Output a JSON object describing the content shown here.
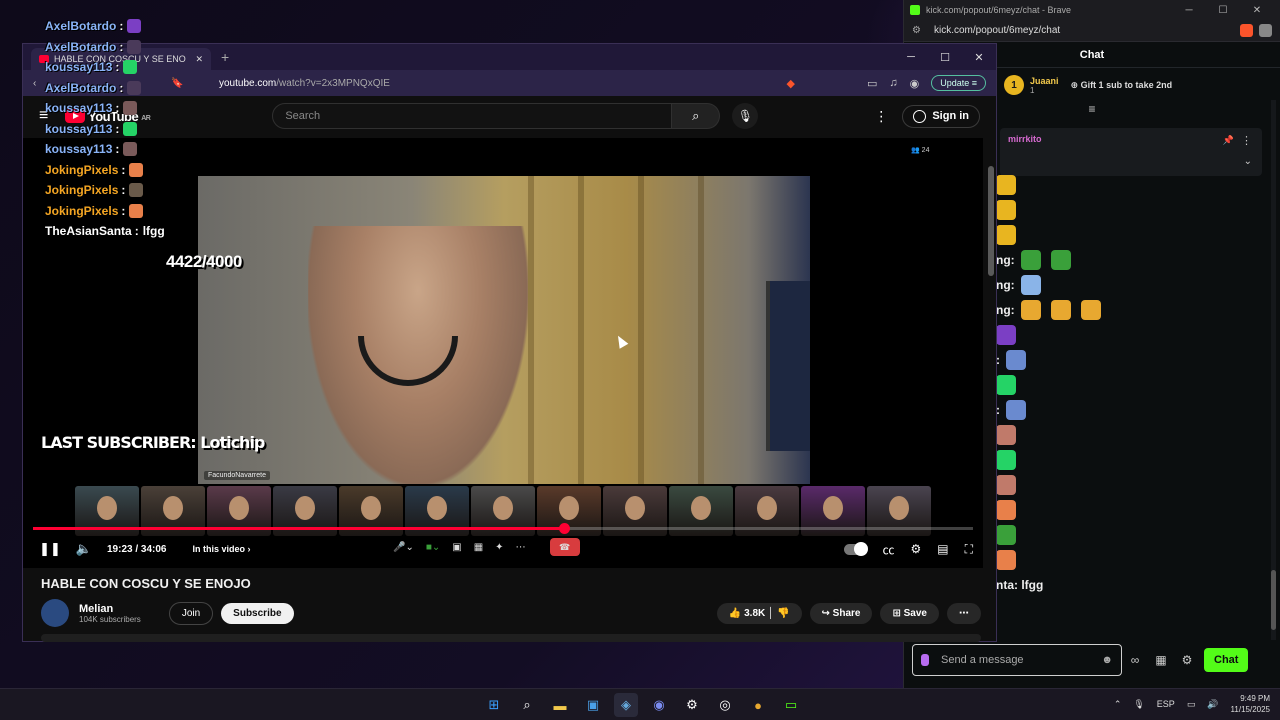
{
  "overlay": {
    "chat": [
      {
        "user": "AxelBotardo",
        "text": "",
        "color": "#8ab4f8",
        "emote": "#7b3fc4"
      },
      {
        "user": "AxelBotardo",
        "text": "",
        "color": "#8ab4f8",
        "emote": "#4a3a5a"
      },
      {
        "user": "koussay113",
        "text": "",
        "color": "#8ab4f8",
        "emote": "#25d366"
      },
      {
        "user": "AxelBotardo",
        "text": "",
        "color": "#8ab4f8",
        "emote": "#4a3a5a"
      },
      {
        "user": "koussay113",
        "text": "",
        "color": "#8ab4f8",
        "emote": "#7a5a5a"
      },
      {
        "user": "koussay113",
        "text": "",
        "color": "#8ab4f8",
        "emote": "#25d366"
      },
      {
        "user": "koussay113",
        "text": "",
        "color": "#8ab4f8",
        "emote": "#7a5a5a"
      },
      {
        "user": "JokingPixels",
        "text": "",
        "color": "#f5a623",
        "emote": "#e8804a"
      },
      {
        "user": "JokingPixels",
        "text": "",
        "color": "#f5a623",
        "emote": "#6a5a4a"
      },
      {
        "user": "JokingPixels",
        "text": "",
        "color": "#f5a623",
        "emote": "#e8804a"
      },
      {
        "user": "TheAsianSanta",
        "text": "lfgg",
        "color": "#ffffff",
        "emote": ""
      }
    ],
    "sub_goal": "4422/4000",
    "last_subscriber": "LAST SUBSCRIBER: Lotichip"
  },
  "kick": {
    "window_title": "kick.com/popout/6meyz/chat - Brave",
    "url": "kick.com/popout/6meyz/chat",
    "chat_header": "Chat",
    "gifter": {
      "rank": "1",
      "name": "Juaani",
      "count": "1",
      "cta": "Gift 1 sub to take 2nd"
    },
    "pinned_user": "mirrkito",
    "messages": [
      {
        "prefix": "",
        "emotes": [
          "#e8b520"
        ]
      },
      {
        "prefix": "",
        "emotes": [
          "#e8b520"
        ]
      },
      {
        "prefix": "",
        "emotes": [
          "#e8b520"
        ]
      },
      {
        "prefix": "ng:",
        "emotes": [
          "#3aa03a",
          "#3aa03a"
        ]
      },
      {
        "prefix": "ng:",
        "emotes": [
          "#8ab4e8"
        ]
      },
      {
        "prefix": "ng:",
        "emotes": [
          "#e8a830",
          "#e8a830",
          "#e8a830"
        ]
      },
      {
        "prefix": "",
        "emotes": [
          "#7b3fc4"
        ]
      },
      {
        "prefix": ":",
        "emotes": [
          "#6a8acf"
        ]
      },
      {
        "prefix": "",
        "emotes": [
          "#25d366"
        ]
      },
      {
        "prefix": ":",
        "emotes": [
          "#6a8acf"
        ]
      },
      {
        "prefix": "",
        "emotes": [
          "#c07a6a"
        ]
      },
      {
        "prefix": "",
        "emotes": [
          "#25d366"
        ]
      },
      {
        "prefix": "",
        "emotes": [
          "#c07a6a"
        ]
      },
      {
        "prefix": "",
        "emotes": [
          "#e8804a"
        ]
      },
      {
        "prefix": "",
        "emotes": [
          "#3aa03a"
        ]
      },
      {
        "prefix": "",
        "emotes": [
          "#e8804a"
        ]
      },
      {
        "prefix": "nta: lfgg",
        "emotes": []
      }
    ],
    "input_placeholder": "Send a message",
    "chat_button": "Chat"
  },
  "youtube": {
    "tab_title": "HABLE CON COSCU Y SE ENO",
    "url_host": "youtube.com",
    "url_path": "/watch?v=2x3MPNQxQIE",
    "update_label": "Update",
    "logo_text": "YouTube",
    "logo_region": "AR",
    "search_placeholder": "Search",
    "signin_label": "Sign in",
    "viewer_count": "24",
    "video_tag": "FacundoNavarrete",
    "progress": 0.565,
    "time_display": "19:23 / 34:06",
    "chapter_label": "In this video",
    "video_title": "HABLE CON COSCU Y SE ENOJO",
    "channel_name": "Melian",
    "channel_subs": "104K subscribers",
    "join_label": "Join",
    "subscribe_label": "Subscribe",
    "like_count": "3.8K",
    "share_label": "Share",
    "save_label": "Save"
  },
  "taskbar": {
    "language": "ESP",
    "time": "9:49 PM",
    "date": "11/15/2025"
  }
}
